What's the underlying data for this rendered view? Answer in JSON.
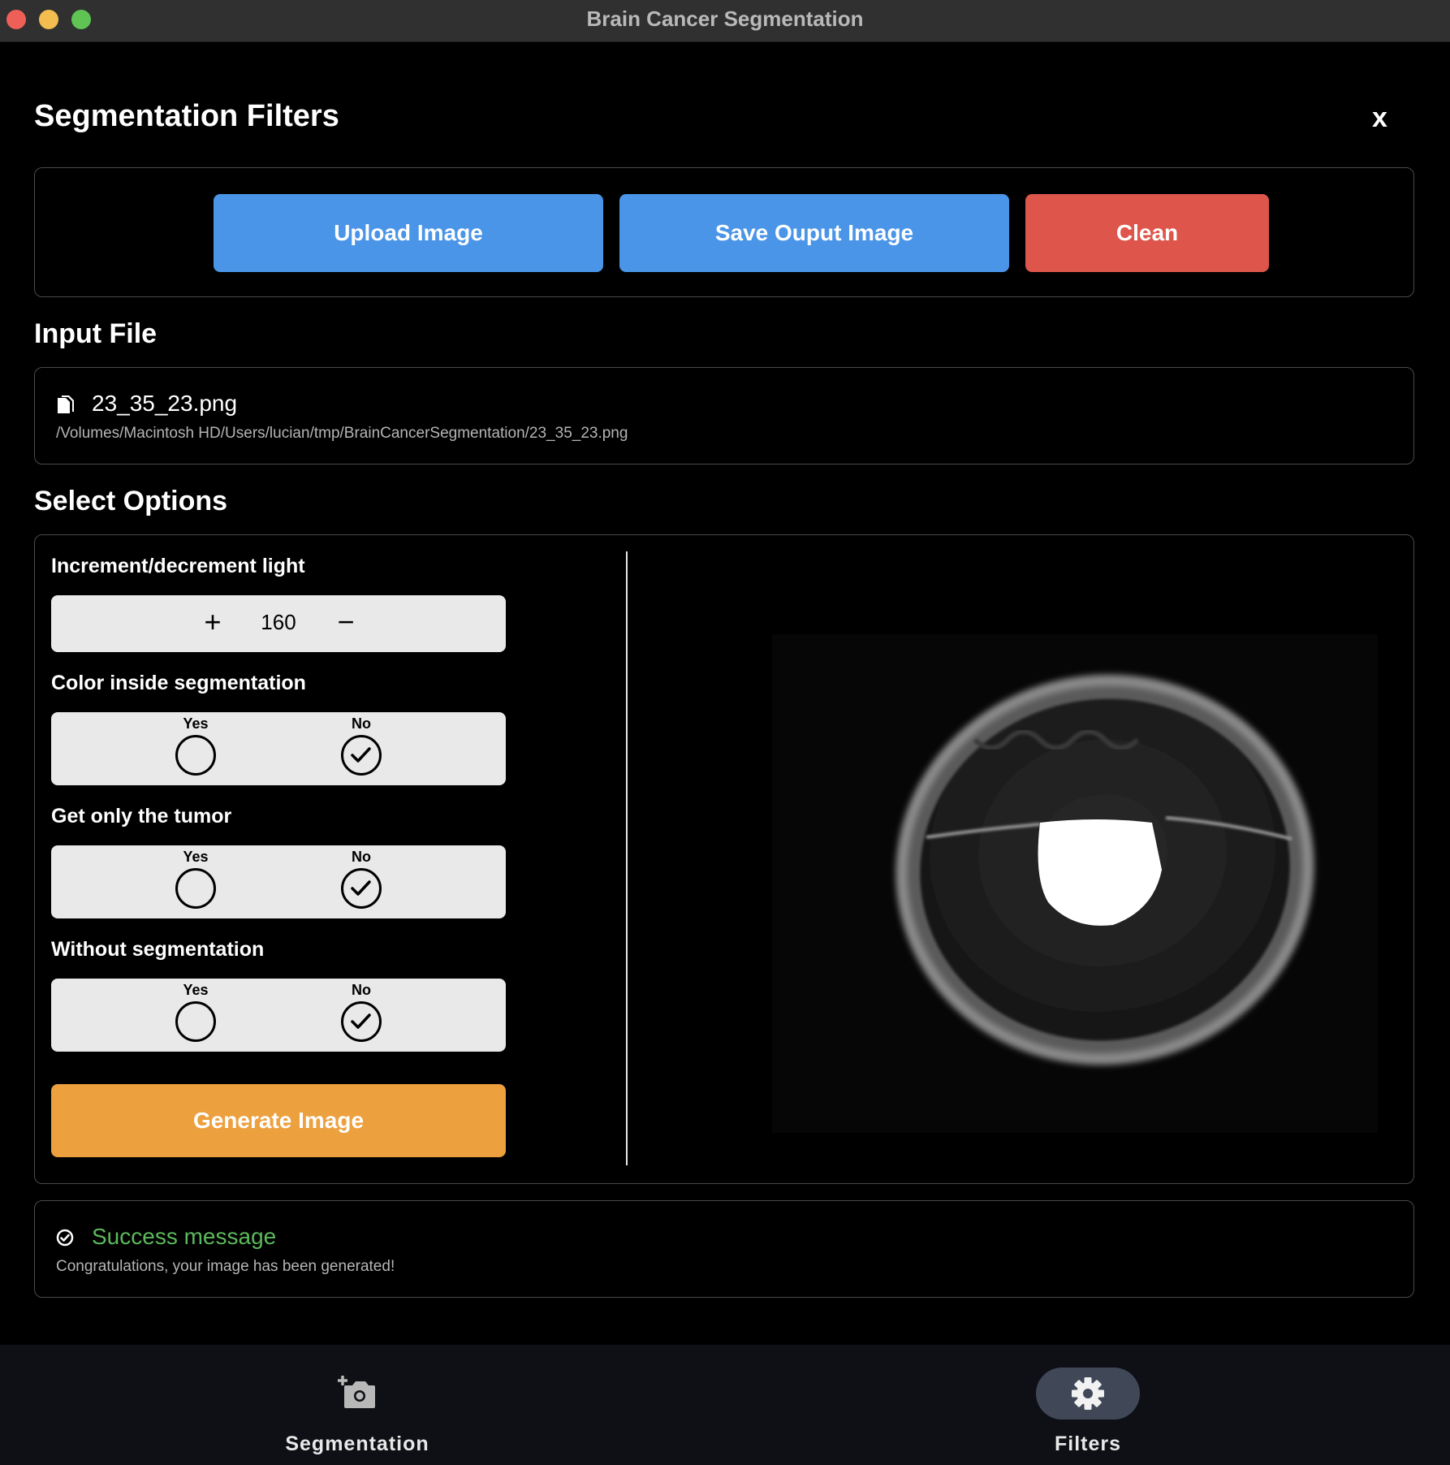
{
  "window": {
    "title": "Brain Cancer Segmentation"
  },
  "header": {
    "title": "Segmentation Filters",
    "close_label": "x"
  },
  "actions": {
    "upload_label": "Upload Image",
    "save_label": "Save Ouput Image",
    "clean_label": "Clean"
  },
  "input_file": {
    "section_title": "Input File",
    "file_name": "23_35_23.png",
    "file_path": "/Volumes/Macintosh HD/Users/lucian/tmp/BrainCancerSegmentation/23_35_23.png"
  },
  "options": {
    "section_title": "Select Options",
    "light": {
      "label": "Increment/decrement light",
      "plus": "+",
      "value": "160",
      "minus": "−"
    },
    "color_inside": {
      "label": "Color inside segmentation",
      "yes": "Yes",
      "no": "No",
      "selected": "No"
    },
    "only_tumor": {
      "label": "Get only the tumor",
      "yes": "Yes",
      "no": "No",
      "selected": "No"
    },
    "without_seg": {
      "label": "Without segmentation",
      "yes": "Yes",
      "no": "No",
      "selected": "No"
    },
    "generate_label": "Generate Image"
  },
  "message": {
    "title": "Success message",
    "text": "Congratulations, your image has been generated!"
  },
  "bottom_nav": {
    "items": [
      {
        "label": "Segmentation",
        "icon": "add-camera-icon",
        "active": false
      },
      {
        "label": "Filters",
        "icon": "gear-icon",
        "active": true
      }
    ]
  },
  "colors": {
    "primary_button": "#4a95e8",
    "danger_button": "#de564b",
    "generate_button": "#eca03e",
    "success_text": "#5cb85c",
    "nav_active_bg": "#404858"
  }
}
